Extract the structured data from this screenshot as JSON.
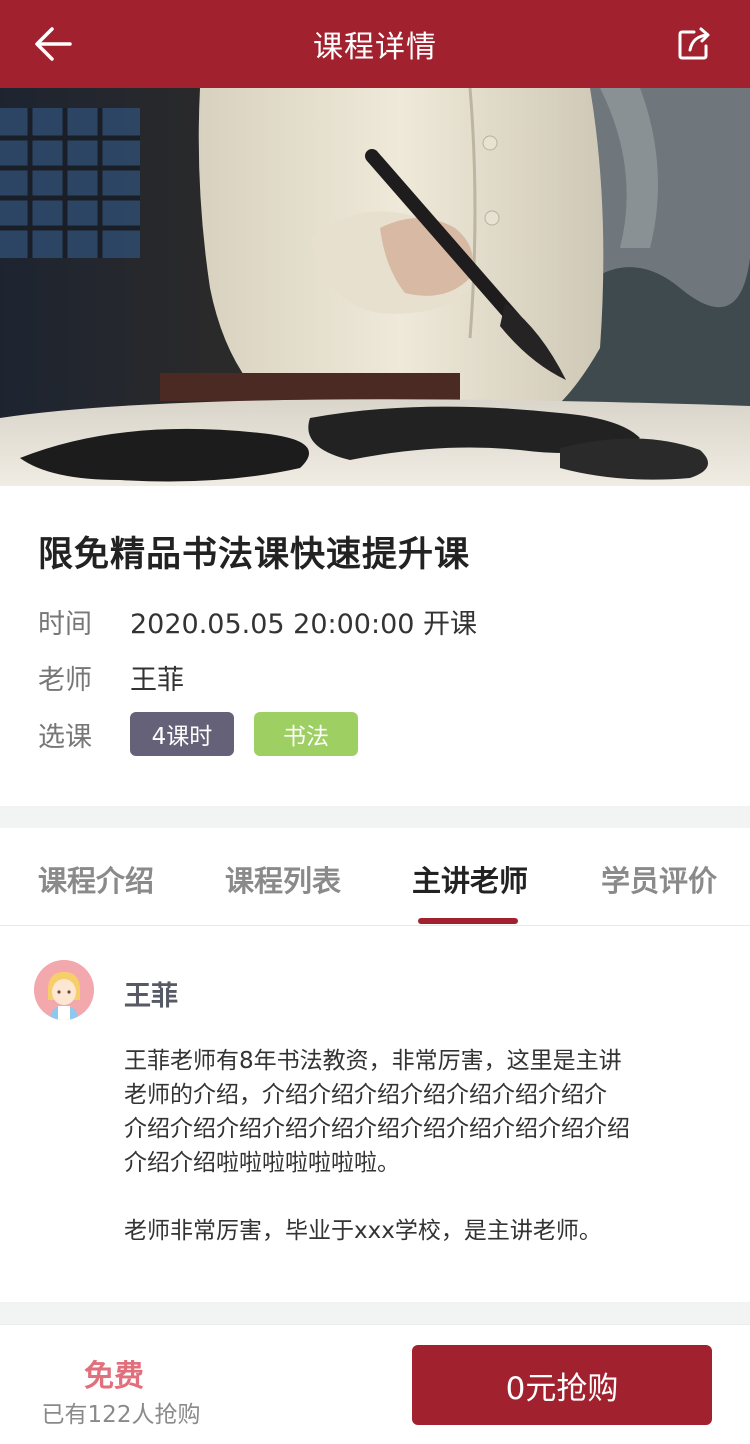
{
  "header": {
    "title": "课程详情",
    "back_icon": "arrow-left-icon",
    "share_icon": "share-icon"
  },
  "hero": {
    "description_icon": "calligraphy-photo"
  },
  "course": {
    "title": "限免精品书法课快速提升课",
    "time_label": "时间",
    "time_value": "2020.05.05 20:00:00 开课",
    "teacher_label": "老师",
    "teacher_value": "王菲",
    "select_label": "选课",
    "tags": [
      "4课时",
      "书法"
    ]
  },
  "tabs": [
    {
      "label": "课程介绍"
    },
    {
      "label": "课程列表"
    },
    {
      "label": "主讲老师"
    },
    {
      "label": "学员评价"
    }
  ],
  "active_tab_index": 2,
  "teacher": {
    "name": "王菲",
    "bio_paragraph_1": "王菲老师有8年书法教资，非常厉害，这里是主讲\n老师的介绍，介绍介绍介绍介绍介绍介绍介绍介\n介绍介绍介绍介绍介绍介绍介绍介绍介绍介绍介绍\n介绍介绍啦啦啦啦啦啦啦。",
    "bio_paragraph_2": "老师非常厉害，毕业于xxx学校，是主讲老师。"
  },
  "bottom": {
    "price": "免费",
    "buyers": "已有122人抢购",
    "buy_label": "0元抢购"
  },
  "colors": {
    "brand": "#a1222e",
    "tag_hours": "#656178",
    "tag_category": "#9dcf63",
    "price": "#e0707c"
  }
}
